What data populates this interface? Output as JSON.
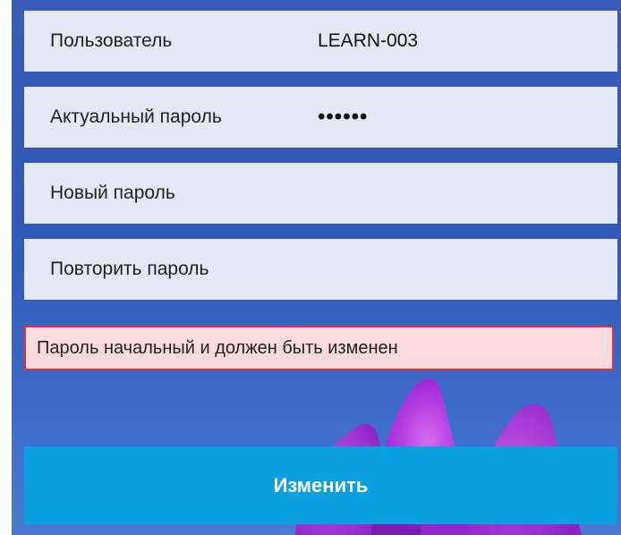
{
  "form": {
    "user": {
      "label": "Пользователь",
      "value": "LEARN-003"
    },
    "current_password": {
      "label": "Актуальный пароль",
      "value": "••••••"
    },
    "new_password": {
      "label": "Новый пароль",
      "value": ""
    },
    "repeat_password": {
      "label": "Повторить пароль",
      "value": ""
    },
    "alert": "Пароль начальный и должен быть изменен",
    "submit_label": "Изменить"
  },
  "colors": {
    "background": "#2f58b8",
    "field_bg": "#e6e8f5",
    "alert_bg": "#fadadd",
    "alert_border": "#d9323c",
    "button_bg": "#0a9fdf",
    "flower": "#a52ad8"
  }
}
